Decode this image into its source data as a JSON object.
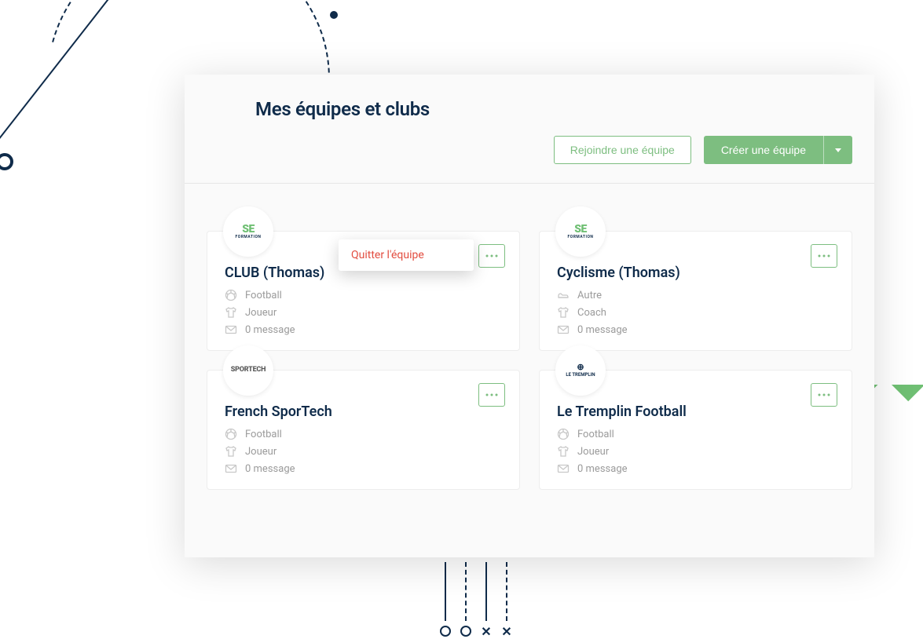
{
  "page": {
    "title": "Mes équipes et clubs"
  },
  "actions": {
    "join_label": "Rejoindre une équipe",
    "create_label": "Créer une équipe"
  },
  "dropdown": {
    "leave_team": "Quitter l'équipe"
  },
  "teams": [
    {
      "name": "CLUB (Thomas)",
      "sport": "Football",
      "role": "Joueur",
      "messages": "0 message",
      "logo_type": "se",
      "has_open_menu": true
    },
    {
      "name": "Cyclisme (Thomas)",
      "sport": "Autre",
      "role": "Coach",
      "messages": "0 message",
      "logo_type": "se",
      "has_open_menu": false
    },
    {
      "name": "French SporTech",
      "sport": "Football",
      "role": "Joueur",
      "messages": "0 message",
      "logo_type": "sportech",
      "has_open_menu": false
    },
    {
      "name": "Le Tremplin Football",
      "sport": "Football",
      "role": "Joueur",
      "messages": "0 message",
      "logo_type": "tremplin",
      "has_open_menu": false
    }
  ],
  "logo_text": {
    "se_main_s": "S",
    "se_main_e": "E",
    "se_sub": "FORMATION",
    "sportech": "SPORTECH",
    "tremplin": "LE TREMPLIN"
  }
}
